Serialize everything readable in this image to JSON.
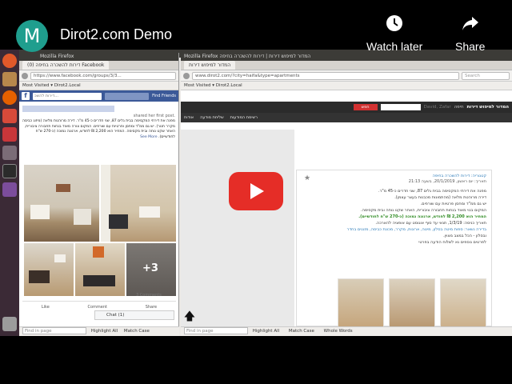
{
  "youtube": {
    "channel_initial": "M",
    "video_title": "Dirot2.com Demo",
    "watch_later_label": "Watch later",
    "share_label": "Share"
  },
  "left_window": {
    "title": "Mozilla Firefox",
    "tab": "דירות להשכרה בחיפה (0) Facebook",
    "url": "https://www.facebook.com/groups/3/3...",
    "bookmarks": "Most Visited ▾    Dirot2.Local",
    "fb_search": "דירות להשכ...",
    "fb_friends": "Find Friends",
    "shared": "shared her first post.",
    "post_text": "מפנה את דירתי המקסימה בבית גלים 87, שני חדרים כ-45 מ\"ר. דירה מרוהטת מלאה (מיזוג כביסה מקרר תנור). יש גם ממ\"ד ומחסן ופרטיות עם שורפים. המקום צורה מאוד בנחות תחבורה ציבורית, האחר שקט נוחה ובית מקסימה. המחיר הוא 2,200 ₪ לחודש, ארנונה נמוכה (כ-270 ש\"ח לחודשיים).",
    "see_more": "See More",
    "plus_count": "+3",
    "comments": "3 Comments",
    "like": "Like",
    "comment": "Comment",
    "share": "Share",
    "chat": "Chat (1)",
    "find_placeholder": "Find in page",
    "highlight_all": "Highlight All",
    "match_case": "Match Case"
  },
  "right_window": {
    "title": "Mozilla Firefox   המדור למיפוש דירות | דירות להשכרה בחיפה",
    "tab": "המדור למיפוש דירות",
    "url": "www.dirot2.com/?city=haifa&type=apartments",
    "search_placeholder": "Search",
    "bookmarks": "Most Visited ▾    Dirot2.Local",
    "nav_brand": "המדור למיפוש דירות",
    "nav_city": "חיפה",
    "nav_item": "David, Zafar",
    "nav_btn": "חפש",
    "sub_items": [
      "רשימת המודעות",
      "שליחת מודעה",
      "אודות"
    ],
    "listing_category": "קטגוריה: דירות להשכרה בחיפה",
    "listing_date": "תאריך: יום ראשון, 20/1/2019, בשעה 21:13",
    "listing_lines": [
      "מפנה את דירתי המקסימה בבית גלים 87, שני חדרים כ-45 מ\"ר.",
      "דירה מרוהטת מלאה (מהתמונות מכבנות בעצר עצמן).",
      "יש גם ממ\"ד ומחסן פרטיות עם שורפים.",
      "המקום בנוי מאוד בנחות תחבורה ציבורית, האחר שקט נוחה ובית מקסימה.",
      "המחיר הוא 2,200 ₪ לחודש, ארנונה נמוכה (כ-270 ש\"ח לחודשיים).",
      "תאריך כניסה: 1/3/19, תנאי עד סוף אוגוסט עם אופציה להארכה.",
      "בדירה נשאר: ספות מיטה בסלון, מיטה, ארונות, מקרר, מכונת כביסה, מזגנים בחדר",
      "ובסלון - הכל במצב מצוין.",
      "לפרטים נוספים נא לשלוח הודעה בפרטי"
    ],
    "find_placeholder": "Find in page",
    "highlight_all": "Highlight All",
    "match_case": "Match Case",
    "whole_words": "Whole Words"
  },
  "launcher_label": "Firefox Web Browser"
}
